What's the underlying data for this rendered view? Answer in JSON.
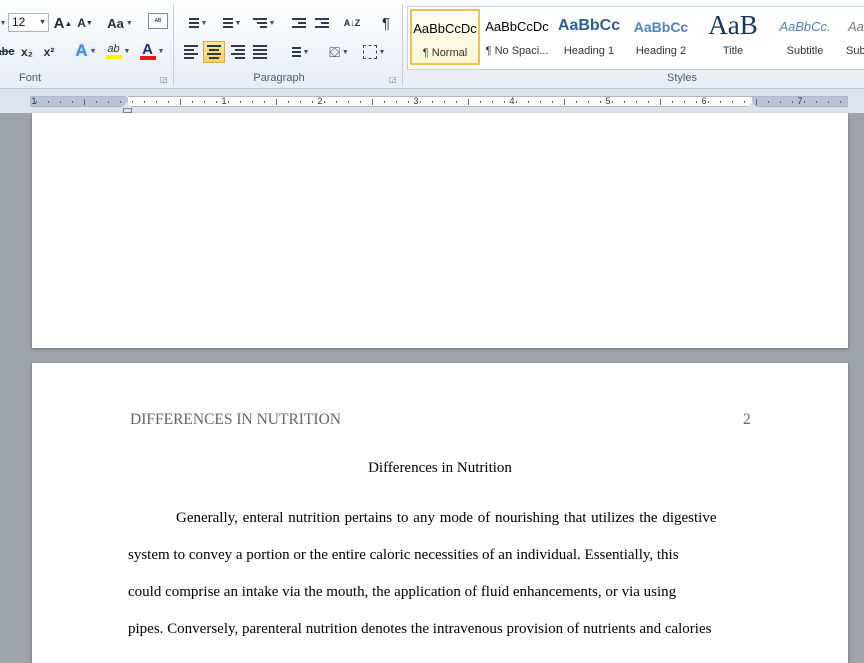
{
  "ribbon": {
    "font": {
      "label": "Font",
      "size_value": "12",
      "grow_label": "A",
      "shrink_label": "A",
      "change_case_label": "Aa",
      "clear_format_label": "ᴬᴮ",
      "strike_label": "abc",
      "subscript_label": "x₂",
      "superscript_label": "x²",
      "effects_label": "A",
      "highlight_label": "ab",
      "font_color_label": "A",
      "highlight_color": "#f6f200",
      "font_color": "#e3171d"
    },
    "paragraph": {
      "label": "Paragraph",
      "pilcrow": "¶",
      "sort_label": "A↓Z",
      "align_active": "center"
    },
    "styles": {
      "label": "Styles",
      "items": [
        {
          "preview": "AaBbCcDc",
          "name": "¶ Normal"
        },
        {
          "preview": "AaBbCcDc",
          "name": "¶ No Spaci..."
        },
        {
          "preview": "AaBbCc",
          "name": "Heading 1"
        },
        {
          "preview": "AaBbCc",
          "name": "Heading 2"
        },
        {
          "preview": "AaB",
          "name": "Title"
        },
        {
          "preview": "AaBbCc.",
          "name": "Subtitle"
        },
        {
          "preview": "Aa",
          "name": "Sub"
        }
      ]
    }
  },
  "ruler": {
    "numbers": [
      "1",
      "1",
      "2",
      "3",
      "4",
      "5",
      "6",
      "7"
    ]
  },
  "document": {
    "page2": {
      "header_left": "DIFFERENCES IN NUTRITION",
      "header_right": "2",
      "title": "Differences in Nutrition",
      "lines": [
        "Generally, enteral nutrition pertains to any mode of nourishing that utilizes the digestive",
        "system to convey a portion or the entire caloric necessities of an individual. Essentially, this",
        "could comprise an intake via the mouth, the application of fluid enhancements, or via using",
        "pipes. Conversely, parenteral nutrition denotes the intravenous provision of nutrients and calories"
      ]
    }
  }
}
